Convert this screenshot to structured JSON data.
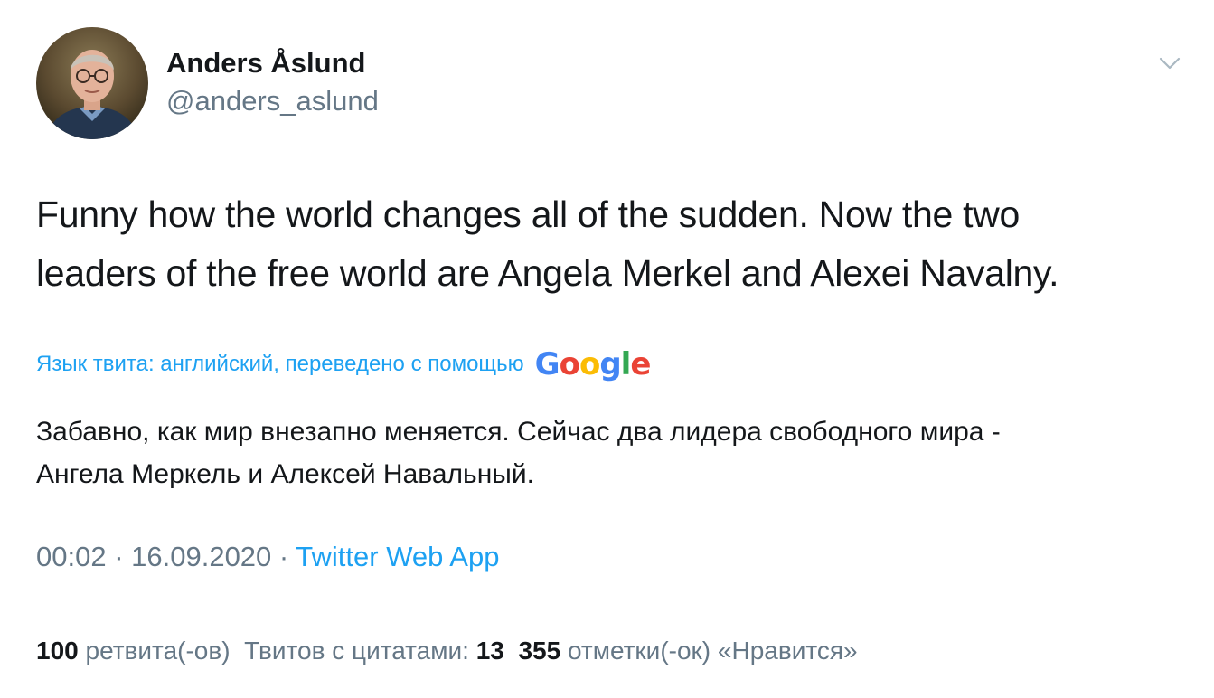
{
  "author": {
    "display_name": "Anders Åslund",
    "handle": "@anders_aslund",
    "avatar_icon": "person-photo"
  },
  "menu": {
    "caret_icon": "chevron-down-icon"
  },
  "tweet": {
    "text_line1": "Funny how the world changes all of the sudden. Now the two",
    "text_line2": "leaders of the free world are Angela Merkel and Alexei Navalny."
  },
  "translate": {
    "label": "Язык твита: английский, переведено с помощью",
    "provider_letters": [
      "G",
      "o",
      "o",
      "g",
      "l",
      "e"
    ],
    "provider_colors": [
      "#4285F4",
      "#EA4335",
      "#FBBC05",
      "#4285F4",
      "#34A853",
      "#EA4335"
    ],
    "translation_line1": "Забавно, как мир внезапно меняется. Сейчас два лидера свободного мира -",
    "translation_line2": "Ангела Меркель и Алексей Навальный."
  },
  "meta": {
    "time": "00:02",
    "separator": " · ",
    "date": "16.09.2020",
    "source": "Twitter Web App"
  },
  "stats": {
    "retweets_count": "100",
    "retweets_label": "ретвита(-ов)",
    "quotes_label": "Твитов с цитатами:",
    "quotes_count": "13",
    "likes_count": "355",
    "likes_label": "отметки(-ок) «Нравится»"
  },
  "colors": {
    "link": "#1da1f2",
    "secondary_text": "#657786",
    "primary_text": "#14171a",
    "divider": "#e1e8ed"
  }
}
